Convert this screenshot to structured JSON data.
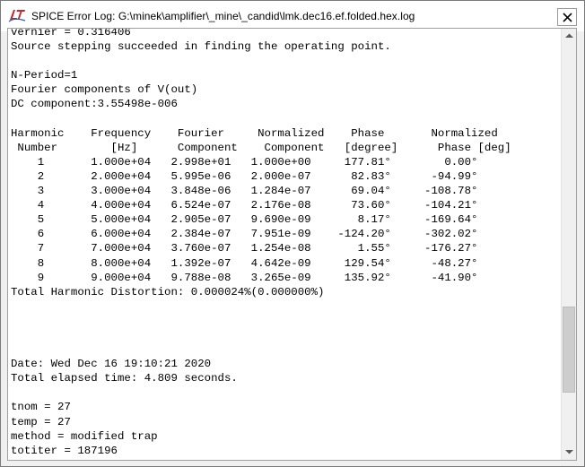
{
  "window": {
    "title": "SPICE Error Log: G:\\minek\\amplifier\\_mine\\_candid\\lmk.dec16.ef.folded.hex.log",
    "icon": "ltspice-logo-icon",
    "close_icon": "close-icon"
  },
  "log": {
    "lines": [
      "vernier = 0.316406",
      "Source stepping succeeded in finding the operating point.",
      "",
      "N-Period=1",
      "Fourier components of V(out)",
      "DC component:3.55498e-006",
      "",
      "Harmonic    Frequency    Fourier     Normalized    Phase       Normalized",
      " Number        [Hz]      Component    Component   [degree]      Phase [deg]",
      "    1       1.000e+04   2.998e+01   1.000e+00     177.81°        0.00°",
      "    2       2.000e+04   5.995e-06   2.000e-07      82.83°      -94.99°",
      "    3       3.000e+04   3.848e-06   1.284e-07      69.04°     -108.78°",
      "    4       4.000e+04   6.524e-07   2.176e-08      73.60°     -104.21°",
      "    5       5.000e+04   2.905e-07   9.690e-09       8.17°     -169.64°",
      "    6       6.000e+04   2.384e-07   7.951e-09    -124.20°     -302.02°",
      "    7       7.000e+04   3.760e-07   1.254e-08       1.55°     -176.27°",
      "    8       8.000e+04   1.392e-07   4.642e-09     129.54°      -48.27°",
      "    9       9.000e+04   9.788e-08   3.265e-09     135.92°      -41.90°",
      "Total Harmonic Distortion: 0.000024%(0.000000%)",
      "",
      "",
      "",
      "",
      "Date: Wed Dec 16 19:10:21 2020",
      "Total elapsed time: 4.809 seconds.",
      "",
      "tnom = 27",
      "temp = 27",
      "method = modified trap",
      "totiter = 187196"
    ]
  },
  "scrollbar": {
    "up_icon": "scroll-up-arrow-icon",
    "down_icon": "scroll-down-arrow-icon"
  }
}
